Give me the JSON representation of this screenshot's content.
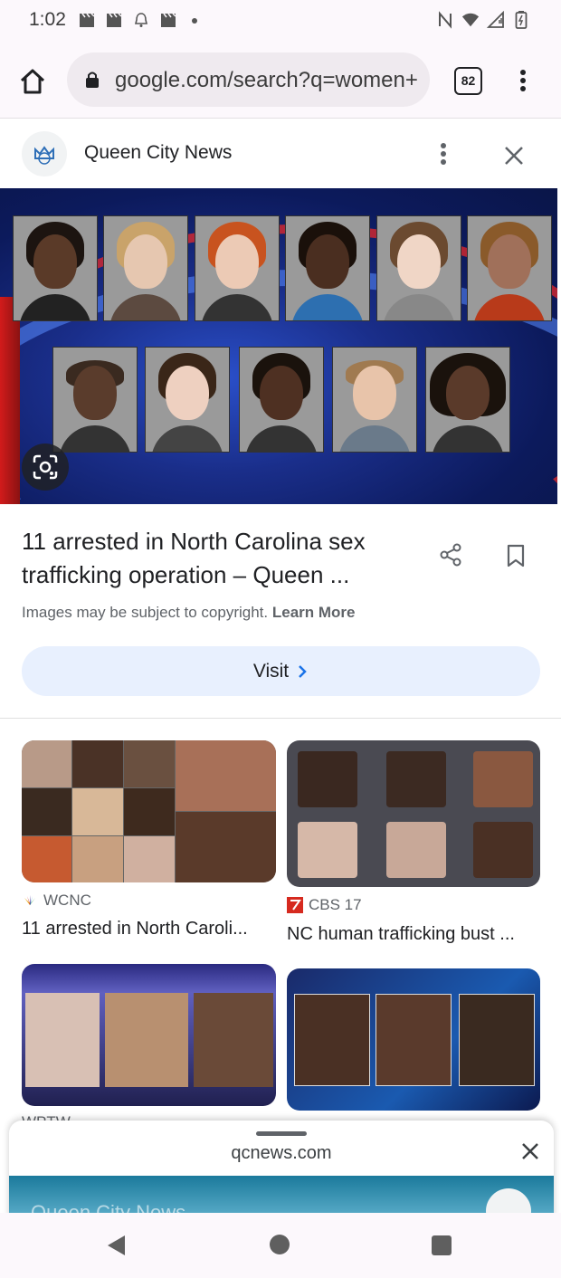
{
  "status_bar": {
    "time": "1:02",
    "icons_left": [
      "clapper-icon",
      "clapper-icon",
      "bell-icon",
      "clapper-icon",
      "dot-icon"
    ],
    "icons_right": [
      "nfc-icon",
      "wifi-icon",
      "signal-icon",
      "battery-icon"
    ]
  },
  "toolbar": {
    "url": "google.com/search?q=women+",
    "tab_count": "82"
  },
  "source": {
    "name": "Queen City News"
  },
  "result": {
    "title": "11 arrested in North Carolina sex trafficking operation – Queen ...",
    "copyright_text": "Images may be subject to copyright.",
    "learn_more": "Learn More",
    "visit_label": "Visit"
  },
  "related": [
    {
      "source": "WCNC",
      "title": "11 arrested in North Caroli..."
    },
    {
      "source": "CBS 17",
      "title": "NC human trafficking bust ..."
    },
    {
      "source": "WPTW",
      "title": ""
    },
    {
      "source": "",
      "title": ""
    }
  ],
  "sheet": {
    "domain": "qcnews.com",
    "preview_title": "Queen City News"
  },
  "colors": {
    "accent_blue": "#1a73e8",
    "visit_bg": "#e8f0fe",
    "hero_blue": "#1a2e8a"
  }
}
